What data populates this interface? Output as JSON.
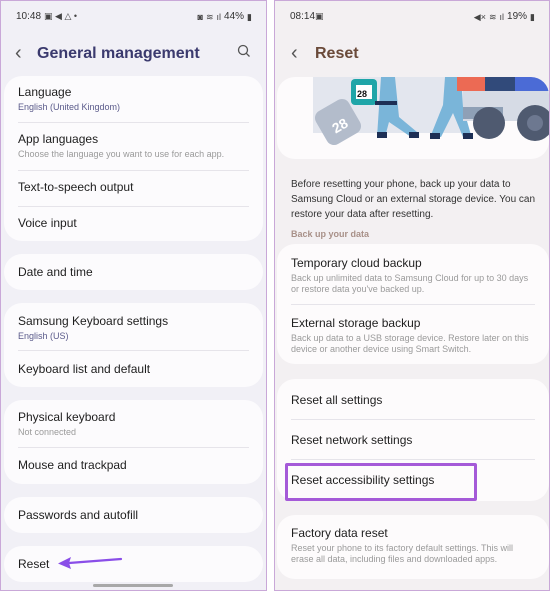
{
  "left": {
    "status": {
      "time": "10:48",
      "left_icons": [
        "gallery-icon",
        "telegram-icon",
        "drive-icon",
        "dot-icon"
      ],
      "battery": "44%",
      "right_icons": [
        "alarm-icon",
        "wifi-icon",
        "volte-icon",
        "signal-icon",
        "battery-icon"
      ]
    },
    "title": "General management",
    "groups": [
      {
        "items": [
          {
            "title": "Language",
            "subtitle": "English (United Kingdom)",
            "sub_style": "accent"
          },
          {
            "title": "App languages",
            "subtitle": "Choose the language you want to use for each app.",
            "sub_style": "muted"
          },
          {
            "title": "Text-to-speech output"
          },
          {
            "title": "Voice input"
          }
        ]
      },
      {
        "items": [
          {
            "title": "Date and time"
          }
        ]
      },
      {
        "items": [
          {
            "title": "Samsung Keyboard settings",
            "subtitle": "English (US)",
            "sub_style": "accent"
          },
          {
            "title": "Keyboard list and default"
          }
        ]
      },
      {
        "items": [
          {
            "title": "Physical keyboard",
            "subtitle": "Not connected",
            "sub_style": "muted"
          },
          {
            "title": "Mouse and trackpad"
          }
        ]
      },
      {
        "items": [
          {
            "title": "Passwords and autofill"
          }
        ]
      },
      {
        "items": [
          {
            "title": "Reset"
          }
        ]
      }
    ],
    "annotation_color": "#8a4ee8"
  },
  "right": {
    "status": {
      "time": "08:14",
      "left_icons": [
        "gallery-icon"
      ],
      "battery": "19%",
      "right_icons": [
        "mute-icon",
        "wifi-icon",
        "signal-icon",
        "battery-icon"
      ]
    },
    "title": "Reset",
    "illustration_calendar_number": "28",
    "description": "Before resetting your phone, back up your data to Samsung Cloud or an external storage device. You can restore your data after resetting.",
    "section_label": "Back up your data",
    "backup_items": [
      {
        "title": "Temporary cloud backup",
        "subtitle": "Back up unlimited data to Samsung Cloud for up to 30 days or restore data you've backed up."
      },
      {
        "title": "External storage backup",
        "subtitle": "Back up data to a USB storage device. Restore later on this device or another device using Smart Switch."
      }
    ],
    "reset_items": [
      {
        "title": "Reset all settings"
      },
      {
        "title": "Reset network settings"
      },
      {
        "title": "Reset accessibility settings",
        "highlighted": true
      }
    ],
    "factory": {
      "title": "Factory data reset",
      "subtitle": "Reset your phone to its factory default settings. This will erase all data, including files and downloaded apps."
    },
    "highlight_color": "#a55ad8"
  }
}
